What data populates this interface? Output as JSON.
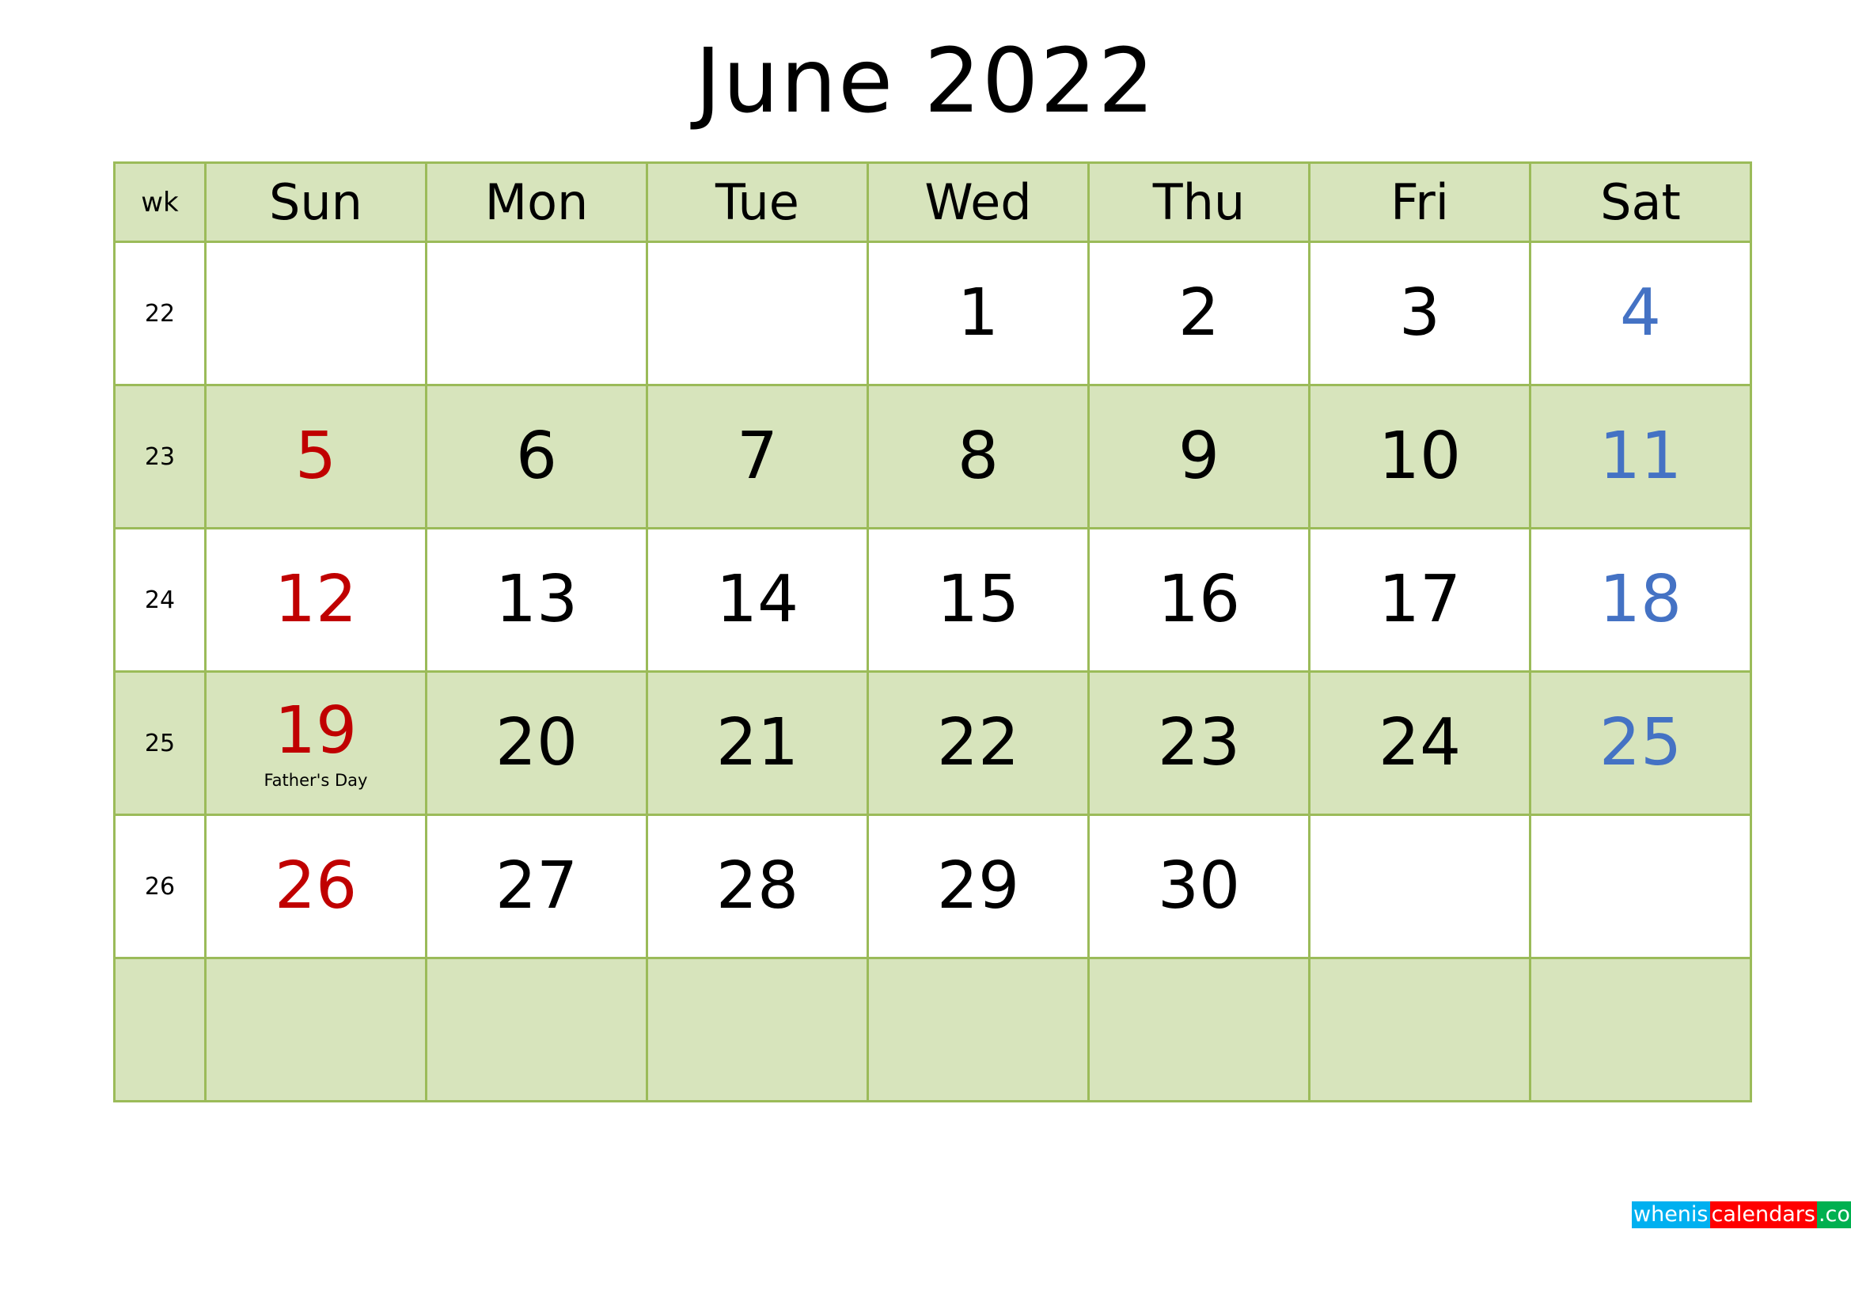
{
  "title": "June 2022",
  "header": {
    "wk_label": "wk",
    "days": [
      "Sun",
      "Mon",
      "Tue",
      "Wed",
      "Thu",
      "Fri",
      "Sat"
    ]
  },
  "colors": {
    "grid_border": "#9BBB59",
    "shaded_fill": "#D7E4BC",
    "sunday_red": "#C00000",
    "saturday_blue": "#4472C4"
  },
  "weeks": [
    {
      "wk": "22",
      "days": [
        "",
        "",
        "",
        "1",
        "2",
        "3",
        "4"
      ],
      "notes": [
        "",
        "",
        "",
        "",
        "",
        "",
        ""
      ]
    },
    {
      "wk": "23",
      "days": [
        "5",
        "6",
        "7",
        "8",
        "9",
        "10",
        "11"
      ],
      "notes": [
        "",
        "",
        "",
        "",
        "",
        "",
        ""
      ]
    },
    {
      "wk": "24",
      "days": [
        "12",
        "13",
        "14",
        "15",
        "16",
        "17",
        "18"
      ],
      "notes": [
        "",
        "",
        "",
        "",
        "",
        "",
        ""
      ]
    },
    {
      "wk": "25",
      "days": [
        "19",
        "20",
        "21",
        "22",
        "23",
        "24",
        "25"
      ],
      "notes": [
        "Father's Day",
        "",
        "",
        "",
        "",
        "",
        ""
      ]
    },
    {
      "wk": "26",
      "days": [
        "26",
        "27",
        "28",
        "29",
        "30",
        "",
        ""
      ],
      "notes": [
        "",
        "",
        "",
        "",
        "",
        "",
        ""
      ]
    },
    {
      "wk": "",
      "days": [
        "",
        "",
        "",
        "",
        "",
        "",
        ""
      ],
      "notes": [
        "",
        "",
        "",
        "",
        "",
        "",
        ""
      ]
    }
  ],
  "logo": {
    "part1": "whenis",
    "part2": "calendars",
    "part3": ".com",
    "colors": [
      "#00B0F0",
      "#FF0000",
      "#00B050"
    ]
  }
}
